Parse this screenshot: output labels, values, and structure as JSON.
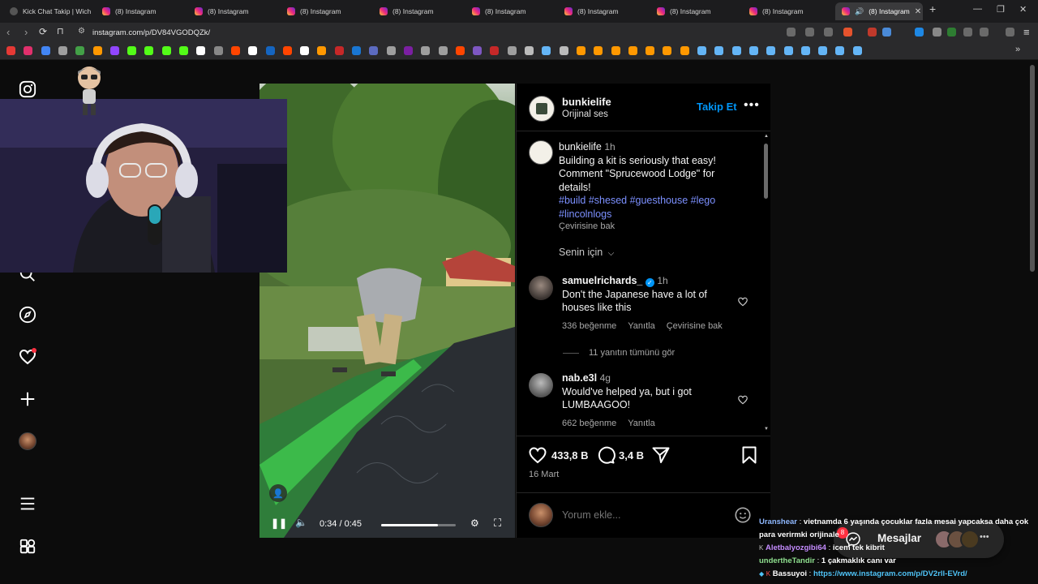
{
  "browser": {
    "tabs": [
      {
        "label": "Kick Chat Takip | Wich",
        "active": false
      },
      {
        "label": "(8) Instagram",
        "active": false
      },
      {
        "label": "(8) Instagram",
        "active": false
      },
      {
        "label": "(8) Instagram",
        "active": false
      },
      {
        "label": "(8) Instagram",
        "active": false
      },
      {
        "label": "(8) Instagram",
        "active": false
      },
      {
        "label": "(8) Instagram",
        "active": false
      },
      {
        "label": "(8) Instagram",
        "active": false
      },
      {
        "label": "(8) Instagram",
        "active": false
      },
      {
        "label": "(8) Instagram",
        "active": true
      }
    ],
    "url": "instagram.com/p/DV84VGODQZk/"
  },
  "video": {
    "time": "0:34 / 0:45",
    "progress": 0.76
  },
  "post": {
    "author": "bunkielife",
    "audio": "Orijinal ses",
    "follow_label": "Takip Et",
    "caption_author": "bunkielife",
    "caption_time": "1h",
    "caption_lines": [
      "Building a kit is seriously that easy!",
      "Comment \"Sprucewood Lodge\" for",
      "details!"
    ],
    "hashtags_line1": "#build #shesed #guesthouse #lego",
    "hashtags_line2": "#lincolnlogs",
    "see_translation": "Çevirisine bak",
    "for_you": "Senin için",
    "comments": [
      {
        "user": "samuelrichards_",
        "time": "1h",
        "verified": true,
        "lines": [
          "Don't the Japanese have a lot of",
          "houses like this"
        ],
        "likes": "336 beğenme",
        "reply": "Yanıtla",
        "translate": "Çevirisine bak"
      },
      {
        "user": "nab.e3l",
        "time": "4g",
        "verified": false,
        "lines": [
          "Would've helped ya, but i got",
          "LUMBAAGOO!"
        ],
        "likes": "662 beğenme",
        "reply": "Yanıtla"
      }
    ],
    "view_replies": "11 yanıtın tümünü gör",
    "like_count": "433,8 B",
    "comment_count": "3,4 B",
    "date": "16 Mart",
    "comment_placeholder": "Yorum ekle..."
  },
  "messages": {
    "label": "Mesajlar",
    "badge": "8"
  },
  "chat": [
    {
      "user": "Uranshear",
      "user_color": "#8fb8ff",
      "text": "vietnamda 6 yaşında çocuklar fazla mesai yapcaksa daha çok",
      "cont": "para verirmki orijinale"
    },
    {
      "user": "Aletbalyozgibi64",
      "user_color": "#c58cff",
      "text": "icem tek kibrit"
    },
    {
      "user": "undertheTandir",
      "user_color": "#8fe08f",
      "text": "1 çakmaklık canı var"
    },
    {
      "user": "Bassuyoi",
      "user_color": "#ffffff",
      "text": "https://www.instagram.com/p/DV2rll-EVrd/"
    }
  ]
}
